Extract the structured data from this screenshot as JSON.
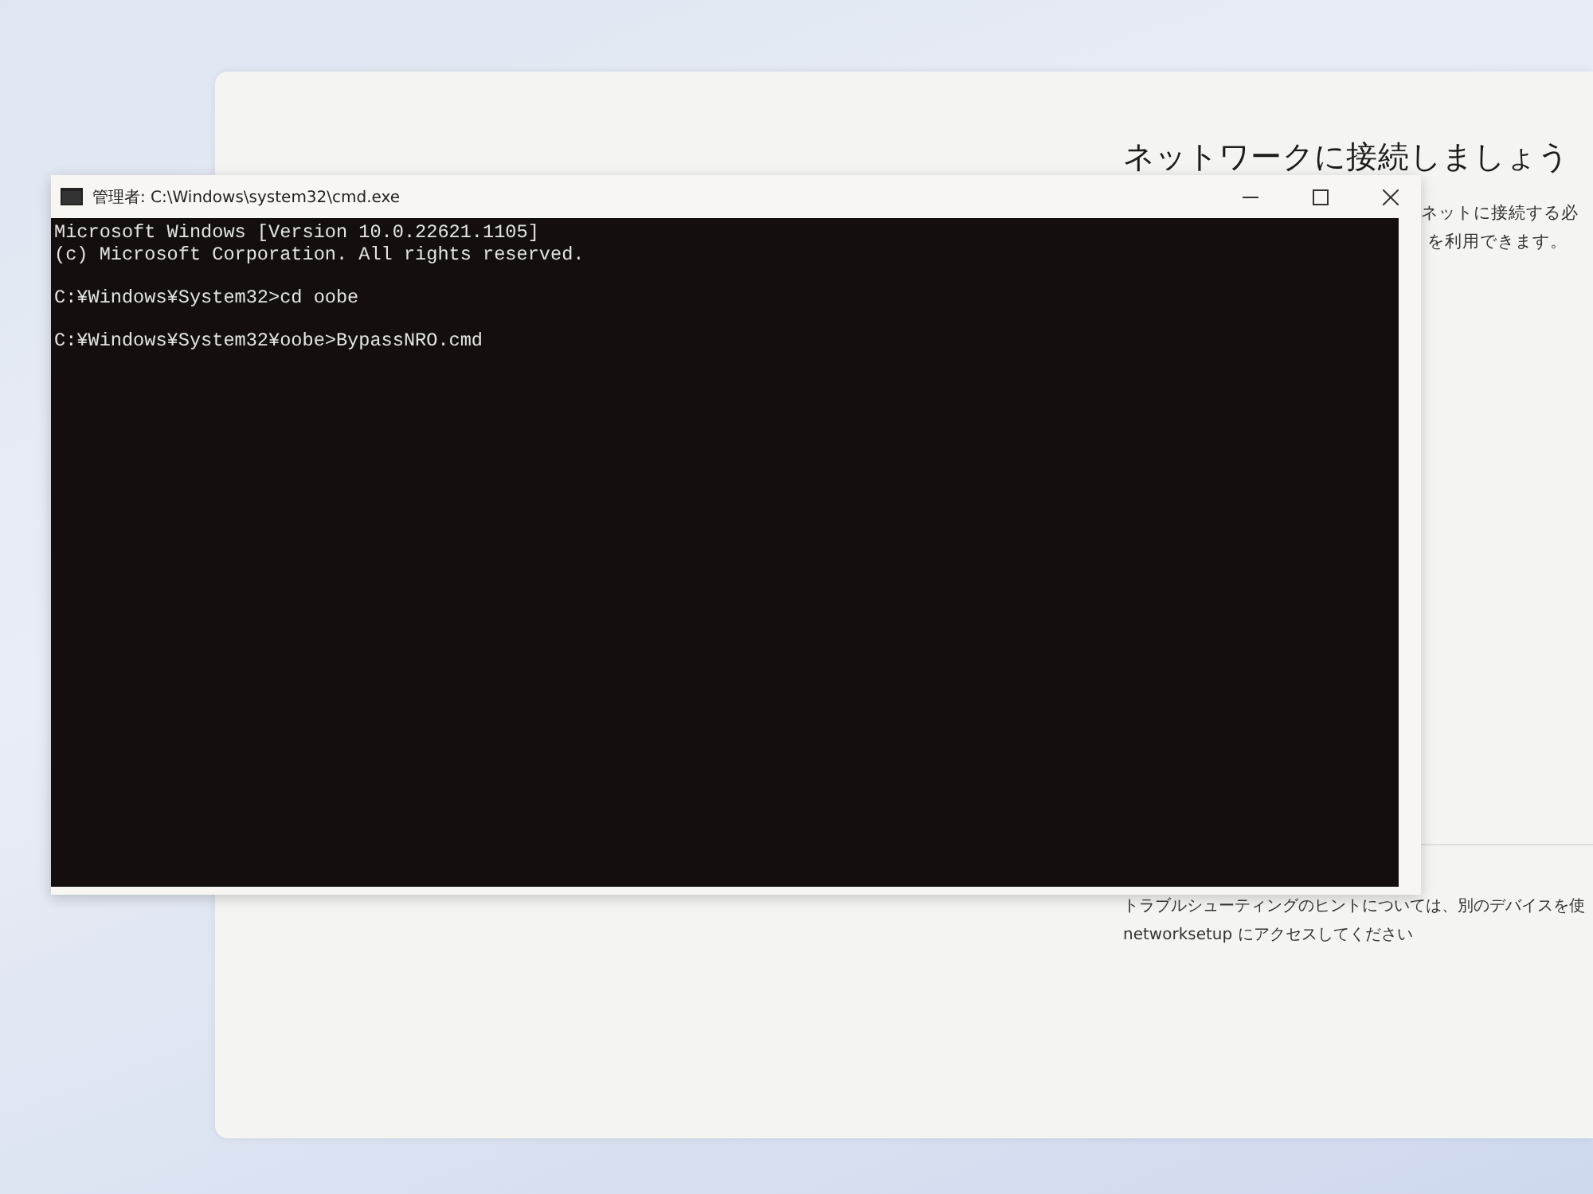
{
  "setup_page": {
    "title": "ネットワークに接続しましょう",
    "text_lines": [
      "ネットに接続する必",
      "を利用できます。"
    ],
    "hint_lines": [
      "トラブルシューティングのヒントについては、別のデバイスを使",
      "networksetup にアクセスしてください"
    ]
  },
  "console_window": {
    "title": "管理者: C:\\Windows\\system32\\cmd.exe",
    "blocks": [
      {
        "lines": [
          "Microsoft Windows [Version 10.0.22621.1105]",
          "(c) Microsoft Corporation. All rights reserved."
        ]
      },
      {
        "lines": [
          "C:¥Windows¥System32>cd oobe"
        ]
      },
      {
        "lines": [
          "C:¥Windows¥System32¥oobe>BypassNRO.cmd"
        ]
      }
    ]
  }
}
